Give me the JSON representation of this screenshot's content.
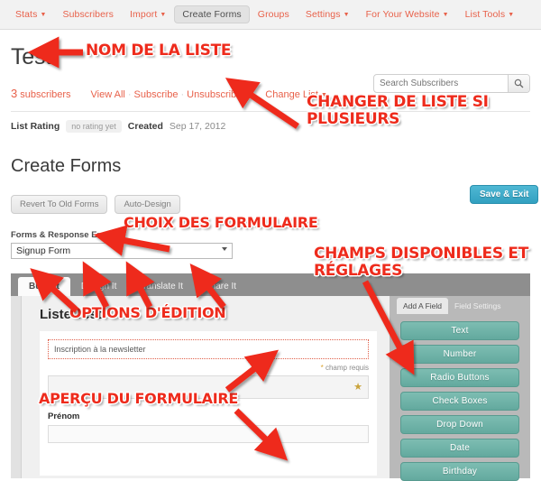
{
  "topnav": {
    "items": [
      {
        "label": "Stats",
        "caret": true,
        "active": false
      },
      {
        "label": "Subscribers",
        "caret": false,
        "active": false
      },
      {
        "label": "Import",
        "caret": true,
        "active": false
      },
      {
        "label": "Create Forms",
        "caret": false,
        "active": true
      },
      {
        "label": "Groups",
        "caret": false,
        "active": false
      },
      {
        "label": "Settings",
        "caret": true,
        "active": false
      },
      {
        "label": "For Your Website",
        "caret": true,
        "active": false
      },
      {
        "label": "List Tools",
        "caret": true,
        "active": false
      }
    ]
  },
  "list": {
    "title": "Test",
    "subscriber_count": "3",
    "subscriber_word": "subscribers",
    "links": [
      "View All",
      "Subscribe",
      "Unsubscribe"
    ],
    "change_list_label": "Change List",
    "rating_label": "List Rating",
    "rating_value": "no rating yet",
    "created_label": "Created",
    "created_value": "Sep 17, 2012"
  },
  "search": {
    "placeholder": "Search Subscribers",
    "value": "",
    "icon": "search-icon"
  },
  "page": {
    "title": "Create Forms",
    "revert_label": "Revert To Old Forms",
    "autodesign_label": "Auto-Design",
    "save_label": "Save & Exit",
    "forms_select_label": "Forms & Response Emails",
    "forms_select_value": "Signup Form"
  },
  "tabs": [
    {
      "label": "Build It",
      "active": true
    },
    {
      "label": "Design It",
      "active": false
    },
    {
      "label": "Translate It",
      "active": false
    },
    {
      "label": "Share It",
      "active": false
    }
  ],
  "preview": {
    "form_heading": "Liste Test",
    "header_text": "Inscription à la newsletter",
    "required_note": "champ requis",
    "required_star": "*",
    "first_field_star": "★",
    "second_field_label": "Prénom"
  },
  "right_panel": {
    "tabs": [
      {
        "label": "Add A Field",
        "active": true
      },
      {
        "label": "Field Settings",
        "active": false
      }
    ],
    "fields": [
      "Text",
      "Number",
      "Radio Buttons",
      "Check Boxes",
      "Drop Down",
      "Date",
      "Birthday"
    ]
  },
  "annotations": [
    {
      "id": "nom-de-la-liste",
      "text": "NOM DE LA LISTE"
    },
    {
      "id": "changer-de-liste",
      "text": "CHANGER DE LISTE SI\nPLUSIEURS"
    },
    {
      "id": "choix-des-formulaire",
      "text": "CHOIX DES FORMULAIRE"
    },
    {
      "id": "champs-disponibles",
      "text": "CHAMPS DISPONIBLES ET\nRÉGLAGES"
    },
    {
      "id": "options-d-edition",
      "text": "OPTIONS D'ÉDITION"
    },
    {
      "id": "apercu-du-formulaire",
      "text": "APERÇU DU FORMULAIRE"
    }
  ],
  "colors": {
    "accent_red": "#e8614a",
    "annotation_red": "#ee2b1c",
    "teal_button": "#6eb5aa",
    "blue_button": "#3ba9c8",
    "tabbar_gray": "#8e8e8e"
  }
}
